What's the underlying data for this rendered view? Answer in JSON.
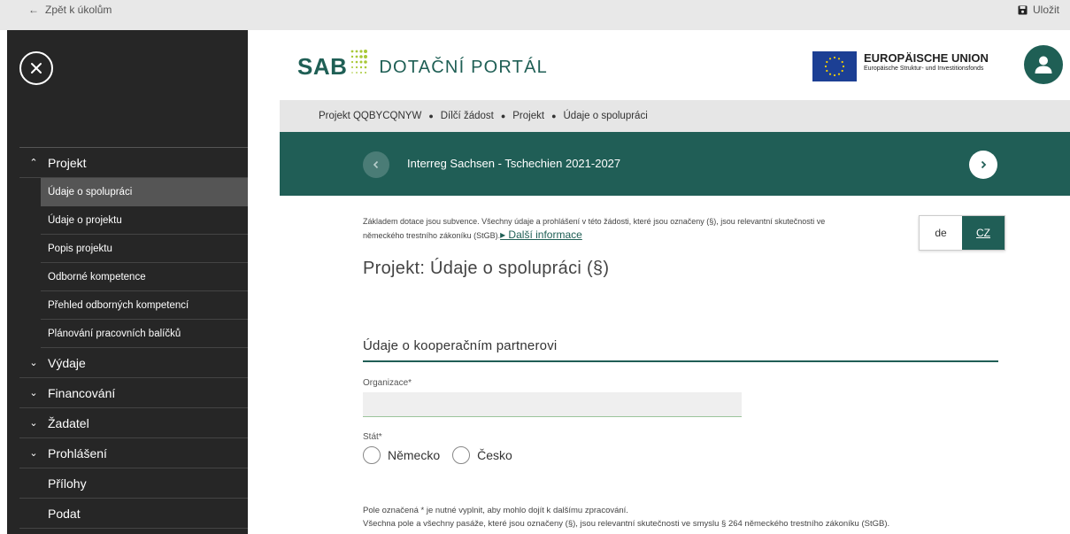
{
  "topbar": {
    "back_label": "Zpět k úkolům",
    "save_label": "Uložit"
  },
  "sidebar": {
    "sections": [
      {
        "label": "Projekt",
        "expanded": true
      },
      {
        "label": "Výdaje"
      },
      {
        "label": "Financování"
      },
      {
        "label": "Žadatel"
      },
      {
        "label": "Prohlášení"
      },
      {
        "label": "Přílohy"
      },
      {
        "label": "Podat"
      }
    ],
    "sub_items": [
      "Údaje o spolupráci",
      "Údaje o projektu",
      "Popis projektu",
      "Odborné kompetence",
      "Přehled odborných kompetencí",
      "Plánování pracovních balíčků"
    ]
  },
  "header": {
    "logo_sab": "SAB",
    "logo_portal": "DOTAČNÍ PORTÁL",
    "eu_title": "EUROPÄISCHE UNION",
    "eu_subtitle": "Europäische Struktur- und Investitionsfonds"
  },
  "breadcrumb": [
    "Projekt QQBYCQNYW",
    "Dílčí žádost",
    "Projekt",
    "Údaje o spolupráci"
  ],
  "program": {
    "title": "Interreg Sachsen - Tschechien 2021-2027"
  },
  "notice": {
    "line1": "Základem dotace jsou subvence. Všechny údaje a prohlášení v této žádosti, které jsou označeny (§), jsou relevantní skutečnosti ve",
    "line2": "německého trestního zákoníku (StGB).",
    "more_label": "▸ Další informace"
  },
  "lang": {
    "de": "de",
    "cz": "CZ"
  },
  "page_title": "Projekt: Údaje o spolupráci (§)",
  "section_title": "Údaje o kooperačním partnerovi",
  "form": {
    "org_label": "Organizace*",
    "org_value": "",
    "state_label": "Stát*",
    "state_options": [
      "Německo",
      "Česko"
    ]
  },
  "footer": {
    "line1": "Pole označená * je nutné vyplnit, aby mohlo dojít k dalšímu zpracování.",
    "line2": "Všechna pole a všechny pasáže, které jsou označeny (§), jsou relevantní skutečnosti ve smyslu § 264 německého trestního zákoníku (StGB)."
  },
  "colors": {
    "brand": "#205e56",
    "sidebar": "#262626",
    "eu_blue": "#1c3f94",
    "eu_star": "#f5d000"
  }
}
